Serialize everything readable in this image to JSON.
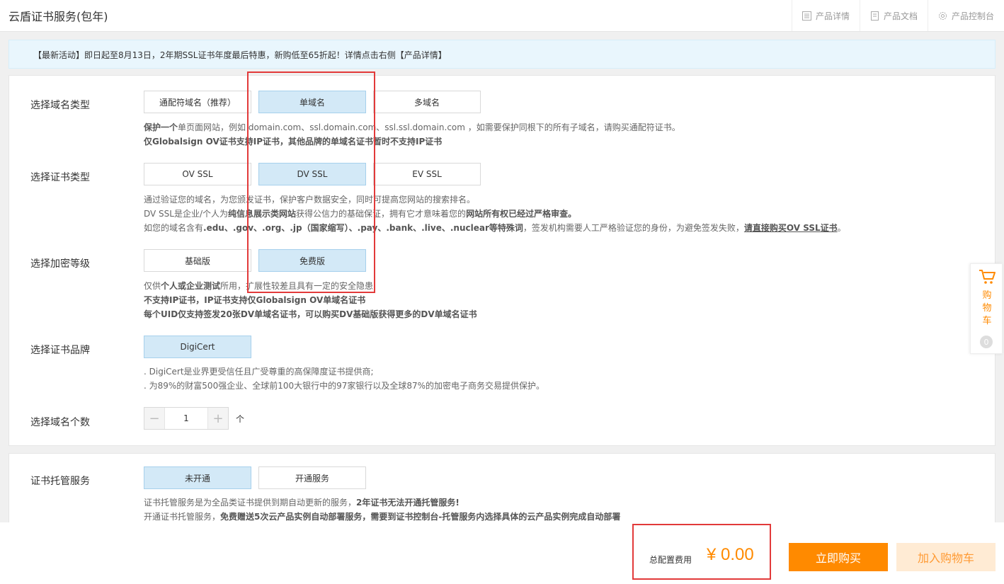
{
  "header": {
    "title": "云盾证书服务(包年)",
    "links": [
      {
        "label": "产品详情",
        "icon": "document-list-icon"
      },
      {
        "label": "产品文档",
        "icon": "document-icon"
      },
      {
        "label": "产品控制台",
        "icon": "gear-icon"
      }
    ]
  },
  "notice": "【最新活动】即日起至8月13日，2年期SSL证书年度最后特惠，新购低至65折起！详情点击右侧【产品详情】",
  "domain_type": {
    "label": "选择域名类型",
    "options": [
      "通配符域名（推荐）",
      "单域名",
      "多域名"
    ],
    "selected": "单域名",
    "desc1_bold": "保护一个",
    "desc1_rest": "单页面网站，例如 domain.com、ssl.domain.com、ssl.ssl.domain.com ，如需要保护同根下的所有子域名，请购买通配符证书。",
    "desc2": "仅Globalsign OV证书支持IP证书，其他品牌的单域名证书暂时不支持IP证书"
  },
  "cert_type": {
    "label": "选择证书类型",
    "options": [
      "OV SSL",
      "DV SSL",
      "EV SSL"
    ],
    "selected": "DV SSL",
    "desc1": "通过验证您的域名，为您颁发证书，保护客户数据安全，同时可提高您网站的搜索排名。",
    "desc2_a": "DV SSL是企业/个人为",
    "desc2_b": "纯信息展示类网站",
    "desc2_c": "获得公信力的基础保证，拥有它才意味着您的",
    "desc2_d": "网站所有权已经过严格审查。",
    "desc3_a": "如您的域名含有",
    "desc3_b": ".edu、.gov、.org、.jp（国家缩写）、.pay、.bank、.live、.nuclear等特殊词",
    "desc3_c": "，签发机构需要人工严格验证您的身份，为避免签发失败，",
    "desc3_d": "请直接购买OV SSL证书",
    "desc3_e": "。"
  },
  "encrypt_level": {
    "label": "选择加密等级",
    "options": [
      "基础版",
      "免费版"
    ],
    "selected": "免费版",
    "desc1_a": "仅供",
    "desc1_b": "个人或企业测试",
    "desc1_c": "所用，扩展性较差且具有一定的安全隐患",
    "desc2": "不支持IP证书，IP证书支持仅Globalsign OV单域名证书",
    "desc3": "每个UID仅支持签发20张DV单域名证书，可以购买DV基础版获得更多的DV单域名证书"
  },
  "brand": {
    "label": "选择证书品牌",
    "options": [
      "DigiCert"
    ],
    "selected": "DigiCert",
    "desc1": ". DigiCert是业界更受信任且广受尊重的高保障度证书提供商;",
    "desc2": ". 为89%的财富500强企业、全球前100大银行中的97家银行以及全球87%的加密电子商务交易提供保护。"
  },
  "domain_count": {
    "label": "选择域名个数",
    "minus": "−",
    "value": "1",
    "plus": "+",
    "unit": "个"
  },
  "hosting": {
    "label": "证书托管服务",
    "options": [
      "未开通",
      "开通服务"
    ],
    "selected": "未开通",
    "desc1_a": "证书托管服务是为全品类证书提供到期自动更新的服务，",
    "desc1_b": "2年证书无法开通托管服务!",
    "desc2_a": "开通证书托管服务，",
    "desc2_b": "免费赠送5次云产品实例自动部署服务，需要到证书控制台-托管服务内选择具体的云产品实例完成自动部署"
  },
  "cart": {
    "label": "购物车",
    "count": "0"
  },
  "footer": {
    "total_label": "总配置费用",
    "total_value": "¥ 0.00",
    "buy_label": "立即购买",
    "add_cart_label": "加入购物车"
  },
  "colors": {
    "accent": "#ff8a00",
    "selected_bg": "#d3e9f7",
    "highlight_box": "#e23a3a"
  }
}
